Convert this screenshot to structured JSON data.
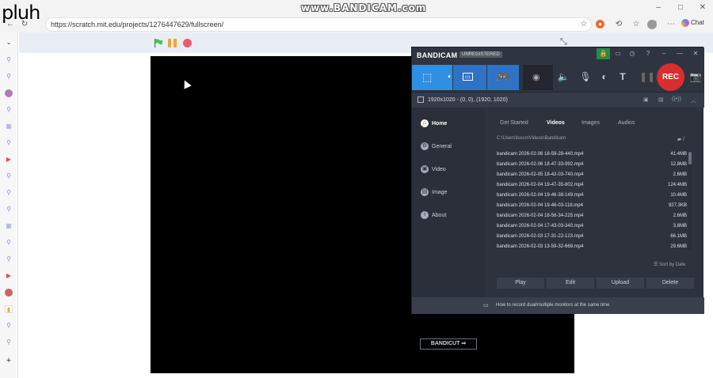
{
  "watermark": {
    "left": "pluh",
    "center": "www.BANDICAM.com"
  },
  "browser": {
    "url": "https://scratch.mit.edu/projects/1276447629/fullscreen/",
    "chat_label": "Chat"
  },
  "bandicam": {
    "brand": "BANDICAM",
    "unregistered": "UNREGISTERED",
    "rec_label": "REC",
    "resolution": "1920x1020 - (0, 0), (1920, 1020)",
    "nav": [
      {
        "label": "Home"
      },
      {
        "label": "General"
      },
      {
        "label": "Video"
      },
      {
        "label": "Image"
      },
      {
        "label": "About"
      }
    ],
    "bandicut_label": "BANDICUT",
    "tabs": [
      "Get Started",
      "Videos",
      "Images",
      "Audios"
    ],
    "path": "C:\\Users\\losco\\Videos\\Bandicam",
    "files": [
      {
        "name": "bandicam 2026-02-06 18-59-28-440.mp4",
        "size": "41.4MB"
      },
      {
        "name": "bandicam 2026-02-06 18-47-33-992.mp4",
        "size": "12.8MB"
      },
      {
        "name": "bandicam 2026-02-05 18-42-03-740.mp4",
        "size": "2.6MB"
      },
      {
        "name": "bandicam 2026-02-04 19-47-35-802.mp4",
        "size": "124.4MB"
      },
      {
        "name": "bandicam 2026-02-04 19-46-38-149.mp4",
        "size": "10.4MB"
      },
      {
        "name": "bandicam 2026-02-04 19-46-03-118.mp4",
        "size": "927.3KB"
      },
      {
        "name": "bandicam 2026-02-04 18-56-34-225.mp4",
        "size": "2.6MB"
      },
      {
        "name": "bandicam 2026-02-04 17-43-03-340.mp4",
        "size": "3.8MB"
      },
      {
        "name": "bandicam 2026-02-03 17-31-22-123.mp4",
        "size": "66.1MB"
      },
      {
        "name": "bandicam 2026-02-03 13-59-32-669.mp4",
        "size": "29.6MB"
      }
    ],
    "sort_label": "Sort by Date",
    "actions": [
      "Play",
      "Edit",
      "Upload",
      "Delete"
    ],
    "footer_tip": "How to record dual/multiple monitors at the same time"
  }
}
